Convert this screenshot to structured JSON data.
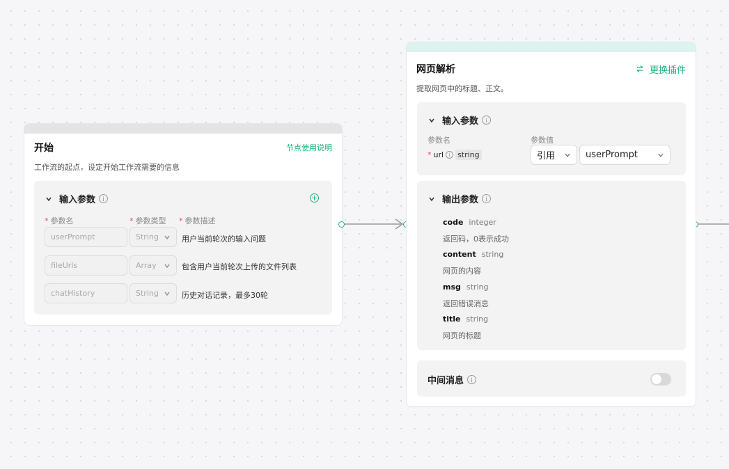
{
  "start_node": {
    "title": "开始",
    "help_link": "节点使用说明",
    "description": "工作流的起点，设定开始工作流需要的信息",
    "input_section": {
      "title": "输入参数",
      "columns": {
        "name": "参数名",
        "type": "参数类型",
        "desc": "参数描述"
      },
      "rows": [
        {
          "name": "userPrompt",
          "type": "String",
          "desc": "用户当前轮次的输入问题"
        },
        {
          "name": "fileUrls",
          "type": "Array",
          "desc": "包含用户当前轮次上传的文件列表"
        },
        {
          "name": "chatHistory",
          "type": "String",
          "desc": "历史对话记录，最多30轮"
        }
      ]
    }
  },
  "web_node": {
    "title": "网页解析",
    "replace_plugin": "更换插件",
    "description": "提取网页中的标题、正文。",
    "input_section": {
      "title": "输入参数",
      "col_name": "参数名",
      "col_value": "参数值",
      "param": {
        "name": "url",
        "type": "string"
      },
      "mode": "引用",
      "value": "userPrompt"
    },
    "output_section": {
      "title": "输出参数",
      "items": [
        {
          "name": "code",
          "type": "integer",
          "desc": "返回码，0表示成功"
        },
        {
          "name": "content",
          "type": "string",
          "desc": "网页的内容"
        },
        {
          "name": "msg",
          "type": "string",
          "desc": "返回错误消息"
        },
        {
          "name": "title",
          "type": "string",
          "desc": "网页的标题"
        }
      ]
    },
    "message_section": {
      "title": "中间消息",
      "enabled": false
    }
  },
  "colors": {
    "accent": "#22b07d",
    "required": "#e5484d",
    "edge": "#9a9a9a"
  }
}
